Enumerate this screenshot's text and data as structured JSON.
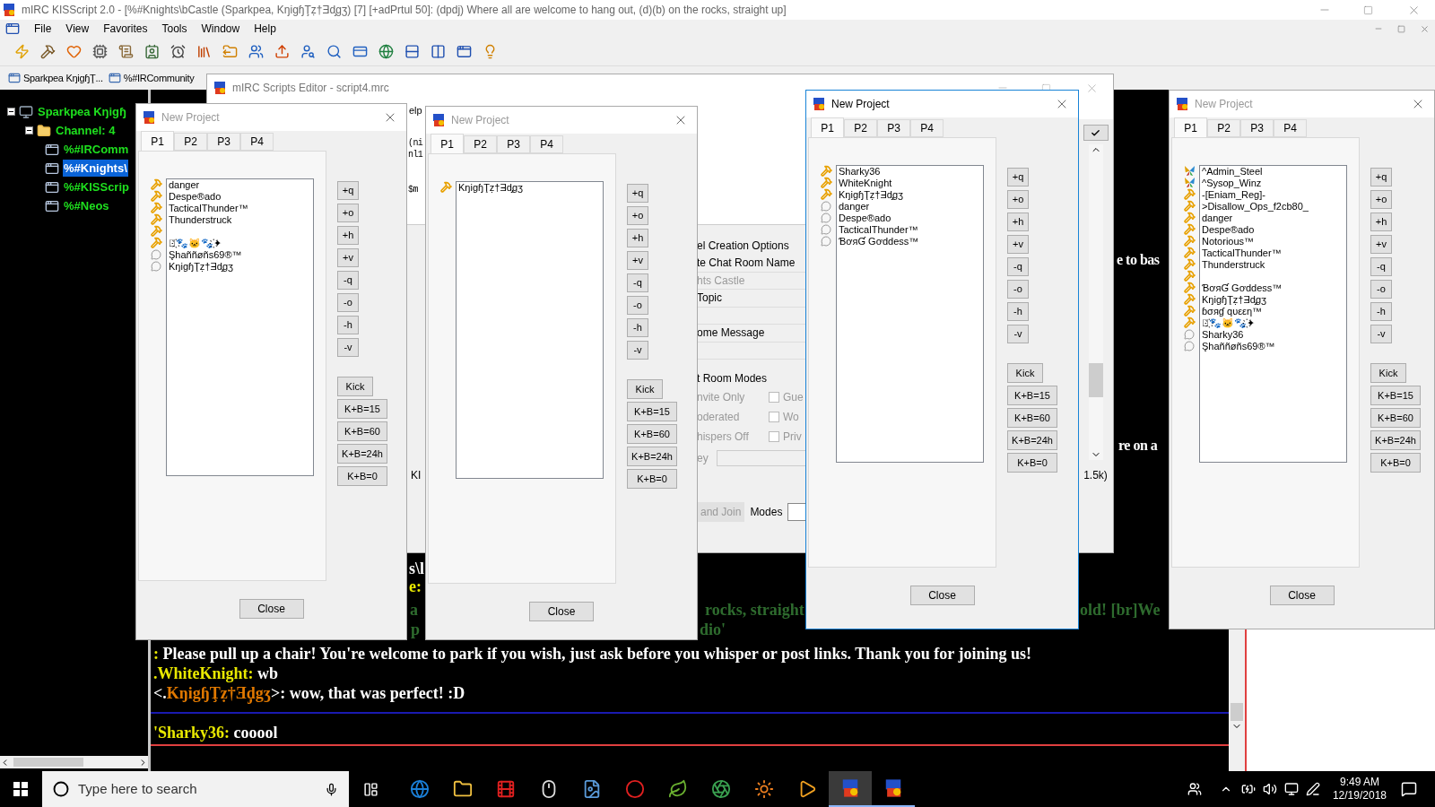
{
  "window": {
    "title": "mIRC KISScript 2.0 - [%#Knights\\bCastle (Sparkpea, KŋigɧŢẓ†Ǝd̡gʒ) [7] [+adPrtul 50]: (dpdj) Where all are welcome to hang out, (d)(b) on the rocks, straight up]"
  },
  "menu": [
    "File",
    "View",
    "Favorites",
    "Tools",
    "Window",
    "Help"
  ],
  "switchbar": [
    {
      "label": "Sparkpea KŋigɧŢ...",
      "selected": false
    },
    {
      "label": "%#IRCommunity",
      "selected": false
    }
  ],
  "tree": {
    "label": "Sparkpea Kŋigɧ",
    "expanded": true,
    "children": [
      {
        "label": "Channel: 4",
        "expanded": true,
        "children": [
          {
            "label": "%#IRComm",
            "selected": false
          },
          {
            "label": "%#Knights\\",
            "selected": true
          },
          {
            "label": "%#KISScrip",
            "selected": false
          },
          {
            "label": "%#Neos",
            "selected": false
          }
        ]
      }
    ]
  },
  "editor": {
    "title": "mIRC Scripts Editor - script4.mrc",
    "menu_fragment": "elp",
    "code_lines": [
      "(ni",
      "nl1",
      "$m"
    ],
    "side_label": "KI",
    "section_title": "el Creation Options",
    "fields": [
      {
        "label": "te Chat Room Name",
        "value": "hts Castle"
      },
      {
        "label": "Topic"
      },
      {
        "label": "ome Message"
      }
    ],
    "modes_title": "t Room Modes",
    "modes": [
      {
        "label": "nvite Only",
        "option": "Gue",
        "checked": false
      },
      {
        "label": "oderated",
        "option": "Wo",
        "checked": false
      },
      {
        "label": "hispers Off",
        "option": "Priv",
        "checked": false
      }
    ],
    "key_label": "ey",
    "join_button": "and Join",
    "modes_label": "Modes",
    "size_label": "1.5k)"
  },
  "dialogs": [
    {
      "title": "New Project",
      "active": false,
      "tabs": [
        {
          "label": "P1",
          "selected": true
        },
        {
          "label": "P2",
          "selected": false
        },
        {
          "label": "P3",
          "selected": false
        },
        {
          "label": "P4",
          "selected": false
        }
      ],
      "nicks": [
        {
          "name": "danger",
          "kind": "op"
        },
        {
          "name": "Despe®ado",
          "kind": "op"
        },
        {
          "name": "TacticalThunder™",
          "kind": "op"
        },
        {
          "name": "Thunderstruck",
          "kind": "op"
        },
        {
          "kind": "op"
        },
        {
          "name": "✦҉🐾🐱🐾҉✦",
          "kind": "op"
        },
        {
          "name": "Şhaññøñs69®™",
          "kind": "regular"
        },
        {
          "name": "KŋigɧŢẓ†Ǝd̡gʒ",
          "kind": "regular"
        }
      ],
      "mode_buttons": [
        "+q",
        "+o",
        "+h",
        "+v",
        "-q",
        "-o",
        "-h",
        "-v"
      ],
      "ban_buttons": [
        "Kick",
        "K+B=15",
        "K+B=60",
        "K+B=24h",
        "K+B=0"
      ],
      "close": "Close"
    },
    {
      "title": "New Project",
      "active": false,
      "tabs": [
        {
          "label": "P1",
          "selected": true
        },
        {
          "label": "P2",
          "selected": false
        },
        {
          "label": "P3",
          "selected": false
        },
        {
          "label": "P4",
          "selected": false
        }
      ],
      "nicks": [
        {
          "name": "KŋigɧŢẓ†Ǝd̡gʒ",
          "kind": "op"
        }
      ],
      "mode_buttons": [
        "+q",
        "+o",
        "+h",
        "+v",
        "-q",
        "-o",
        "-h",
        "-v"
      ],
      "ban_buttons": [
        "Kick",
        "K+B=15",
        "K+B=60",
        "K+B=24h",
        "K+B=0"
      ],
      "close": "Close"
    },
    {
      "title": "New Project",
      "active": true,
      "tabs": [
        {
          "label": "P1",
          "selected": true
        },
        {
          "label": "P2",
          "selected": false
        },
        {
          "label": "P3",
          "selected": false
        },
        {
          "label": "P4",
          "selected": false
        }
      ],
      "nicks": [
        {
          "name": "Sharky36",
          "kind": "op"
        },
        {
          "name": "WhiteKnight",
          "kind": "op"
        },
        {
          "name": "KŋigɧŢẓ†Ǝd̡gʒ",
          "kind": "op"
        },
        {
          "name": "danger",
          "kind": "regular"
        },
        {
          "name": "Despe®ado",
          "kind": "regular"
        },
        {
          "name": "TacticalThunder™",
          "kind": "regular"
        },
        {
          "name": "ƁơяƓ Gơddess™",
          "kind": "regular"
        }
      ],
      "mode_buttons": [
        "+q",
        "+o",
        "+h",
        "+v",
        "-q",
        "-o",
        "-h",
        "-v"
      ],
      "ban_buttons": [
        "Kick",
        "K+B=15",
        "K+B=60",
        "K+B=24h",
        "K+B=0"
      ],
      "close": "Close"
    },
    {
      "title": "New Project",
      "active": false,
      "tabs": [
        {
          "label": "P1",
          "selected": true
        },
        {
          "label": "P2",
          "selected": false
        },
        {
          "label": "P3",
          "selected": false
        },
        {
          "label": "P4",
          "selected": false
        }
      ],
      "nicks": [
        {
          "name": "^Admin_Steel",
          "kind": "admin"
        },
        {
          "name": "^Sysop_Winz",
          "kind": "admin"
        },
        {
          "name": "-[Eniam_Reg]-",
          "kind": "op"
        },
        {
          "name": ">Disallow_Ops_f2cb80_",
          "kind": "op"
        },
        {
          "name": "danger",
          "kind": "op"
        },
        {
          "name": "Despe®ado",
          "kind": "op"
        },
        {
          "name": "Notorious™",
          "kind": "op"
        },
        {
          "name": "TacticalThunder™",
          "kind": "op"
        },
        {
          "name": "Thunderstruck",
          "kind": "op"
        },
        {
          "kind": "op"
        },
        {
          "name": "ƁơяƓ Gơddess™",
          "kind": "op"
        },
        {
          "name": "KŋigɧŢẓ†Ǝd̡gʒ",
          "kind": "op"
        },
        {
          "name": "ɓσяɠ qυεεη™",
          "kind": "op"
        },
        {
          "name": "✦҉🐾🐱🐾҉✦",
          "kind": "op"
        },
        {
          "name": "Sharky36",
          "kind": "regular"
        },
        {
          "name": "Şhaññøñs69®™",
          "kind": "regular"
        }
      ],
      "mode_buttons": [
        "+q",
        "+o",
        "+h",
        "+v",
        "-q",
        "-o",
        "-h",
        "-v"
      ],
      "ban_buttons": [
        "Kick",
        "K+B=15",
        "K+B=60",
        "K+B=24h",
        "K+B=0"
      ],
      "close": "Close"
    }
  ],
  "chat": {
    "fragments": [
      {
        "text": "e to bas",
        "color": "#ffffff"
      },
      {
        "text": "re on a",
        "color": "#ffffff"
      },
      {
        "text": "s\\l",
        "color": "#ffffff"
      },
      {
        "text": "e:",
        "color": "#e8e800"
      },
      {
        "text": "a",
        "color": "#2e6b2e"
      },
      {
        "text": "rocks, straight",
        "color": "#2e6b2e"
      },
      {
        "text": "old! [br]We",
        "color": "#2e6b2e"
      },
      {
        "text": "p",
        "color": "#2e6b2e"
      },
      {
        "text": "dio'",
        "color": "#2e6b2e"
      }
    ],
    "lines": [
      {
        "segments": [
          {
            "text": ":",
            "color": "#e8e800"
          },
          {
            "text": " Please pull up a chair! You're welcome to park if you wish, just ask before you whisper or post links. Thank you for joining us!",
            "color": "#ffffff"
          }
        ]
      },
      {
        "segments": [
          {
            "text": ".WhiteKnight:",
            "color": "#e8e800"
          },
          {
            "text": " wb",
            "color": "#ffffff"
          }
        ]
      },
      {
        "segments": [
          {
            "text": "<.",
            "color": "#ffffff"
          },
          {
            "text": "KŋigɧŢẓ†Ǝd̡gʒ",
            "color": "#e07800"
          },
          {
            "text": ">: wow, that was perfect! :D",
            "color": "#ffffff"
          }
        ]
      }
    ],
    "last_line": {
      "segments": [
        {
          "text": "'Sharky36:",
          "color": "#e8e800"
        },
        {
          "text": " cooool",
          "color": "#ffffff"
        }
      ]
    }
  },
  "taskbar": {
    "search_placeholder": "Type here to search",
    "time": "9:49 AM",
    "date": "12/19/2018"
  }
}
